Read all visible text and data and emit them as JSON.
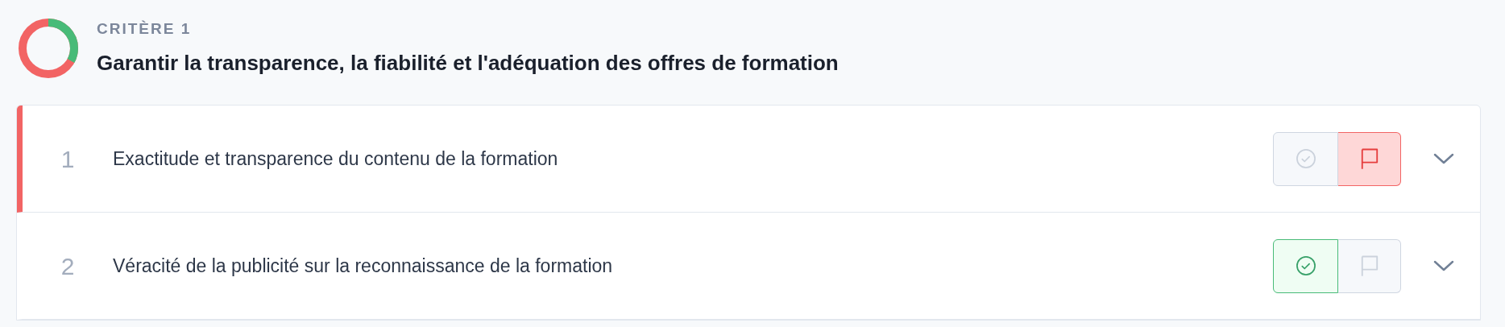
{
  "criterion": {
    "label": "CRITÈRE 1",
    "title": "Garantir la transparence, la fiabilité et l'adéquation des offres de formation",
    "progress": {
      "level": 0.33
    }
  },
  "indicators": [
    {
      "number": "1",
      "text": "Exactitude et transparence du contenu de la formation",
      "validated": false,
      "flagged": true
    },
    {
      "number": "2",
      "text": "Véracité de la publicité sur la reconnaissance de la formation",
      "validated": true,
      "flagged": false
    }
  ]
}
